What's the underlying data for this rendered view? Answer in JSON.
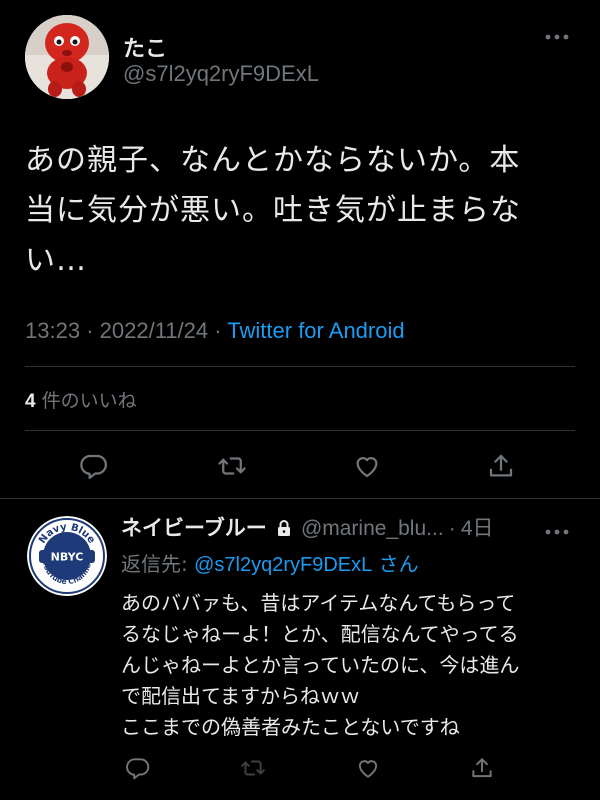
{
  "tweet": {
    "author_name": "たこ",
    "author_handle": "@s7l2yq2ryF9DExL",
    "text": "あの親子、なんとかならないか。本\n当に気分が悪い。吐き気が止まらな\nい…",
    "time": "13:23",
    "date": "2022/11/24",
    "source": "Twitter for Android",
    "likes_count": "4",
    "likes_label": "件のいいね"
  },
  "reply": {
    "author_name": "ネイビーブルー",
    "author_handle": "@marine_blu...",
    "age": "4日",
    "replying_label": "返信先: ",
    "replying_to": "@s7l2yq2ryF9DExL",
    "replying_suffix": " さん",
    "avatar_text_top": "Navy Blue",
    "avatar_text_center": "NBYC",
    "avatar_text_side": "YouTube Channel",
    "text": "あのババァも、昔はアイテムなんてもらって\nるなじゃねーよ！とか、配信なんてやってる\nんじゃねーよとか言っていたのに、今は進ん\nで配信出てますからねｗｗ\nここまでの偽善者みたことないですね"
  },
  "colors": {
    "background": "#000000",
    "text": "#e7e9ea",
    "secondary": "#71767b",
    "link": "#1d9bf0",
    "divider": "#2f3336"
  },
  "icons": [
    "more-icon",
    "reply-icon",
    "retweet-icon",
    "like-icon",
    "share-icon",
    "lock-icon"
  ]
}
